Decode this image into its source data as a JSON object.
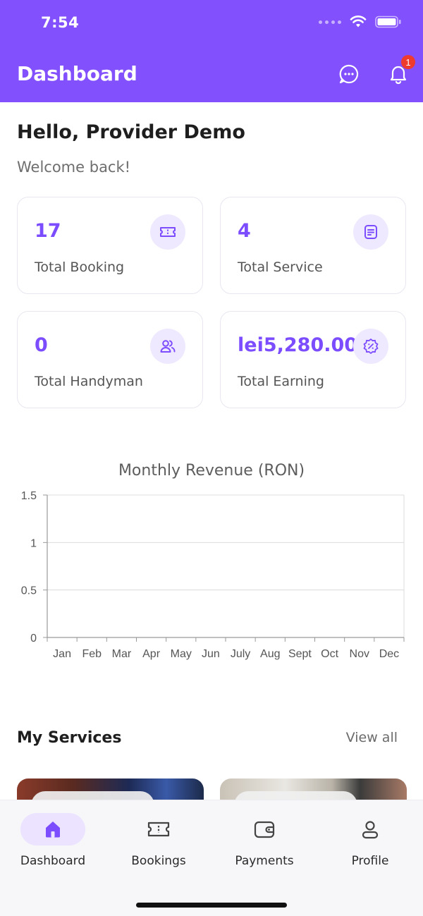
{
  "status_bar": {
    "time": "7:54"
  },
  "header": {
    "title": "Dashboard",
    "notification_count": "1",
    "bg_color": "#8350fd"
  },
  "greeting": {
    "title": "Hello, Provider Demo",
    "subtitle": "Welcome back!"
  },
  "stats": [
    {
      "value": "17",
      "label": "Total Booking",
      "icon": "ticket-icon"
    },
    {
      "value": "4",
      "label": "Total Service",
      "icon": "document-icon"
    },
    {
      "value": "0",
      "label": "Total Handyman",
      "icon": "users-icon"
    },
    {
      "value": "lei5,280.00",
      "label": "Total Earning",
      "icon": "discount-badge-icon"
    }
  ],
  "chart_data": {
    "type": "line",
    "title": "Monthly Revenue (RON)",
    "categories": [
      "Jan",
      "Feb",
      "Mar",
      "Apr",
      "May",
      "Jun",
      "July",
      "Aug",
      "Sept",
      "Oct",
      "Nov",
      "Dec"
    ],
    "series": [
      {
        "values": [
          0,
          0,
          0,
          0,
          0,
          0,
          0,
          0,
          0,
          0,
          0,
          0
        ]
      }
    ],
    "ylim": [
      0,
      1.5
    ],
    "yticks": [
      "0",
      "0.5",
      "1",
      "1.5"
    ],
    "grid": true
  },
  "services": {
    "title": "My Services",
    "view_all": "View all"
  },
  "nav": {
    "items": [
      {
        "label": "Dashboard",
        "icon": "home-icon",
        "active": true
      },
      {
        "label": "Bookings",
        "icon": "ticket-icon",
        "active": false
      },
      {
        "label": "Payments",
        "icon": "wallet-icon",
        "active": false
      },
      {
        "label": "Profile",
        "icon": "user-icon",
        "active": false
      }
    ]
  },
  "colors": {
    "accent": "#7c4dff",
    "accent_light": "#efe9ff"
  }
}
